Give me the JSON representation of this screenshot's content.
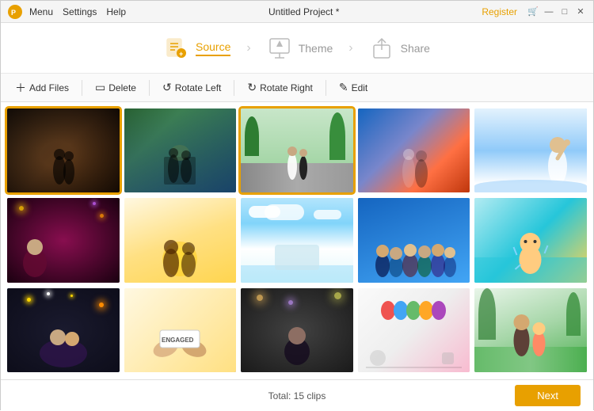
{
  "titleBar": {
    "title": "Untitled Project *",
    "menu": [
      "Menu",
      "Settings",
      "Help"
    ],
    "register": "Register",
    "controls": [
      "—",
      "□",
      "✕"
    ]
  },
  "wizard": {
    "steps": [
      {
        "id": "source",
        "label": "Source",
        "active": true
      },
      {
        "id": "theme",
        "label": "Theme",
        "active": false
      },
      {
        "id": "share",
        "label": "Share",
        "active": false
      }
    ]
  },
  "toolbar": {
    "buttons": [
      {
        "id": "add-files",
        "icon": "+",
        "label": "Add Files"
      },
      {
        "id": "delete",
        "icon": "□",
        "label": "Delete"
      },
      {
        "id": "rotate-left",
        "icon": "↺",
        "label": "Rotate Left"
      },
      {
        "id": "rotate-right",
        "icon": "↻",
        "label": "Rotate Right"
      },
      {
        "id": "edit",
        "icon": "✎",
        "label": "Edit"
      }
    ]
  },
  "media": {
    "items": [
      {
        "id": 1,
        "selected": true
      },
      {
        "id": 2,
        "selected": false
      },
      {
        "id": 3,
        "selected": true
      },
      {
        "id": 4,
        "selected": false
      },
      {
        "id": 5,
        "selected": false
      },
      {
        "id": 6,
        "selected": false
      },
      {
        "id": 7,
        "selected": false
      },
      {
        "id": 8,
        "selected": false
      },
      {
        "id": 9,
        "selected": false
      },
      {
        "id": 10,
        "selected": false
      },
      {
        "id": 11,
        "selected": false
      },
      {
        "id": 12,
        "selected": false
      },
      {
        "id": 13,
        "selected": false
      },
      {
        "id": 14,
        "selected": false
      },
      {
        "id": 15,
        "selected": false
      }
    ]
  },
  "bottomBar": {
    "totalText": "Total: 15 clips",
    "nextLabel": "Next"
  }
}
